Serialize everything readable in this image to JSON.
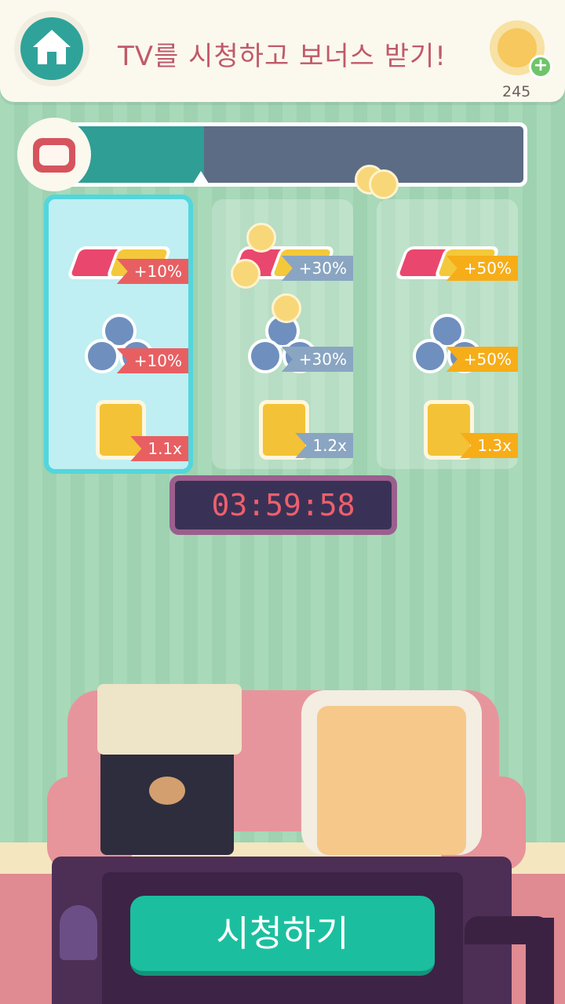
{
  "header": {
    "title": "TV를 시청하고 보너스 받기!",
    "coins": "245",
    "home_icon": "home-icon",
    "add_coins_icon": "plus-icon"
  },
  "progress": {
    "fraction": 0.3
  },
  "cards": [
    {
      "name": "tier-1",
      "active": true,
      "rewards": [
        {
          "icon": "books-icon",
          "value": "+10%"
        },
        {
          "icon": "balls-icon",
          "value": "+10%"
        },
        {
          "icon": "cat-token-icon",
          "value": "1.1x"
        }
      ],
      "tag_color": "#e85f62"
    },
    {
      "name": "tier-2",
      "active": false,
      "rewards": [
        {
          "icon": "books-icon",
          "value": "+30%"
        },
        {
          "icon": "balls-icon",
          "value": "+30%"
        },
        {
          "icon": "cat-token-icon",
          "value": "1.2x"
        }
      ],
      "tag_color": "#8aa5c2"
    },
    {
      "name": "tier-3",
      "active": false,
      "rewards": [
        {
          "icon": "books-icon",
          "value": "+50%"
        },
        {
          "icon": "balls-icon",
          "value": "+50%"
        },
        {
          "icon": "cat-token-icon",
          "value": "1.3x"
        }
      ],
      "tag_color": "#f6ad18"
    }
  ],
  "timer": "03:59:58",
  "watch_button": "시청하기",
  "colors": {
    "accent": "#1bbf9f",
    "home": "#2fa39a",
    "title": "#c05a68"
  }
}
